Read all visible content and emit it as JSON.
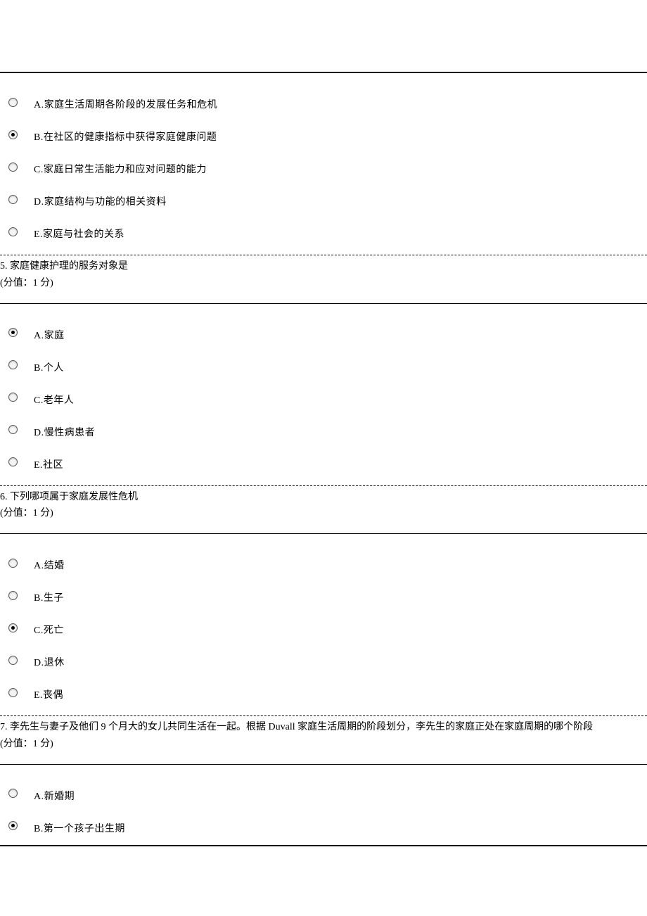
{
  "questions": [
    {
      "number": "",
      "text": "",
      "score": "",
      "options": [
        {
          "label": "A.家庭生活周期各阶段的发展任务和危机",
          "selected": false
        },
        {
          "label": "B.在社区的健康指标中获得家庭健康问题",
          "selected": true
        },
        {
          "label": "C.家庭日常生活能力和应对问题的能力",
          "selected": false
        },
        {
          "label": "D.家庭结构与功能的相关资料",
          "selected": false
        },
        {
          "label": "E.家庭与社会的关系",
          "selected": false
        }
      ]
    },
    {
      "number": "5.",
      "text": "家庭健康护理的服务对象是",
      "score": "(分值：1 分)",
      "options": [
        {
          "label": "A.家庭",
          "selected": true
        },
        {
          "label": "B.个人",
          "selected": false
        },
        {
          "label": "C.老年人",
          "selected": false
        },
        {
          "label": "D.慢性病患者",
          "selected": false
        },
        {
          "label": "E.社区",
          "selected": false
        }
      ]
    },
    {
      "number": "6.",
      "text": "下列哪项属于家庭发展性危机",
      "score": "(分值：1 分)",
      "options": [
        {
          "label": "A.结婚",
          "selected": false
        },
        {
          "label": "B.生子",
          "selected": false
        },
        {
          "label": "C.死亡",
          "selected": true
        },
        {
          "label": "D.退休",
          "selected": false
        },
        {
          "label": "E.丧偶",
          "selected": false
        }
      ]
    },
    {
      "number": "7.",
      "text": "李先生与妻子及他们 9 个月大的女儿共同生活在一起。根据 Duvall 家庭生活周期的阶段划分，李先生的家庭正处在家庭周期的哪个阶段",
      "score": "(分值：1 分)",
      "options": [
        {
          "label": "A.新婚期",
          "selected": false
        },
        {
          "label": "B.第一个孩子出生期",
          "selected": true
        }
      ]
    }
  ]
}
